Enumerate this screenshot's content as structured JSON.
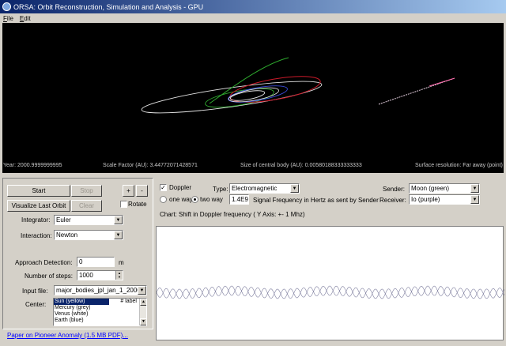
{
  "window": {
    "title": "ORSA: Orbit Reconstruction, Simulation and Analysis - GPU"
  },
  "menu": {
    "items": [
      "File",
      "Edit"
    ]
  },
  "viewport": {
    "year": "Year: 2000.9999999995",
    "scale_factor": "Scale Factor (AU): 3.44772071428571",
    "central_body": "Size of central body (AU): 0.00580188333333333",
    "surface_resolution": "Surface resolution:   Far away (point)"
  },
  "controls": {
    "start_label": "Start",
    "stop_label": "Stop",
    "visualize_label": "Visualize Last Orbit",
    "clear_label": "Clear",
    "plus_label": "+",
    "minus_label": "-",
    "rotate_label": "Rotate",
    "integrator_label": "Integrator:",
    "integrator_value": "Euler",
    "interaction_label": "Interaction:",
    "interaction_value": "Newton",
    "approach_label": "Approach Detection:",
    "approach_value": "0",
    "approach_unit": "m",
    "steps_label": "Number of steps:",
    "steps_value": "1000",
    "input_file_label": "Input file:",
    "input_file_value": "major_bodies_jpl_jan_1_2000.start",
    "center_label": "Center:",
    "center_list": [
      "Sun (yellow)",
      "Mercury (grey)",
      "Venus (white)",
      "Earth (blue)"
    ],
    "center_tag": "# label",
    "paper_link": "Paper on Pioneer Anomaly (1.5 MB PDF)..."
  },
  "doppler": {
    "doppler_label": "Doppler",
    "type_label": "Type:",
    "type_value": "Electromagnetic",
    "sender_label": "Sender:",
    "sender_value": "Moon (green)",
    "receiver_label": "Receiver:",
    "receiver_value": "Io (purple)",
    "one_way_label": "one way",
    "two_way_label": "two way",
    "frequency_value": "1.4E9",
    "frequency_desc": "Signal Frequency in Hertz as sent by Sender",
    "chart_caption": "Chart: Shift in Doppler frequency ( Y Axis: +- 1 Mhz)"
  },
  "colors": {
    "titlebar": "#0a246a",
    "orbit_green": "#2ea82e",
    "orbit_red": "#cc1a2a",
    "orbit_blue": "#3a4ad8",
    "orbit_white": "#e6e6e6",
    "orbit_pink": "#ff66aa"
  }
}
